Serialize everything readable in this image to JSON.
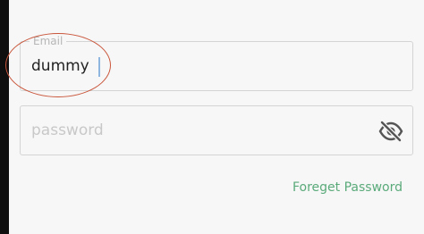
{
  "login_form": {
    "email": {
      "label": "Email",
      "value": "dummy"
    },
    "password": {
      "placeholder": "password",
      "value": "",
      "toggle_icon": "eye-off-icon"
    },
    "forgot_password_label": "Foreget Password"
  },
  "colors": {
    "link": "#5aaa7a",
    "annotation": "#c9553a",
    "caret": "#8fb6de"
  }
}
